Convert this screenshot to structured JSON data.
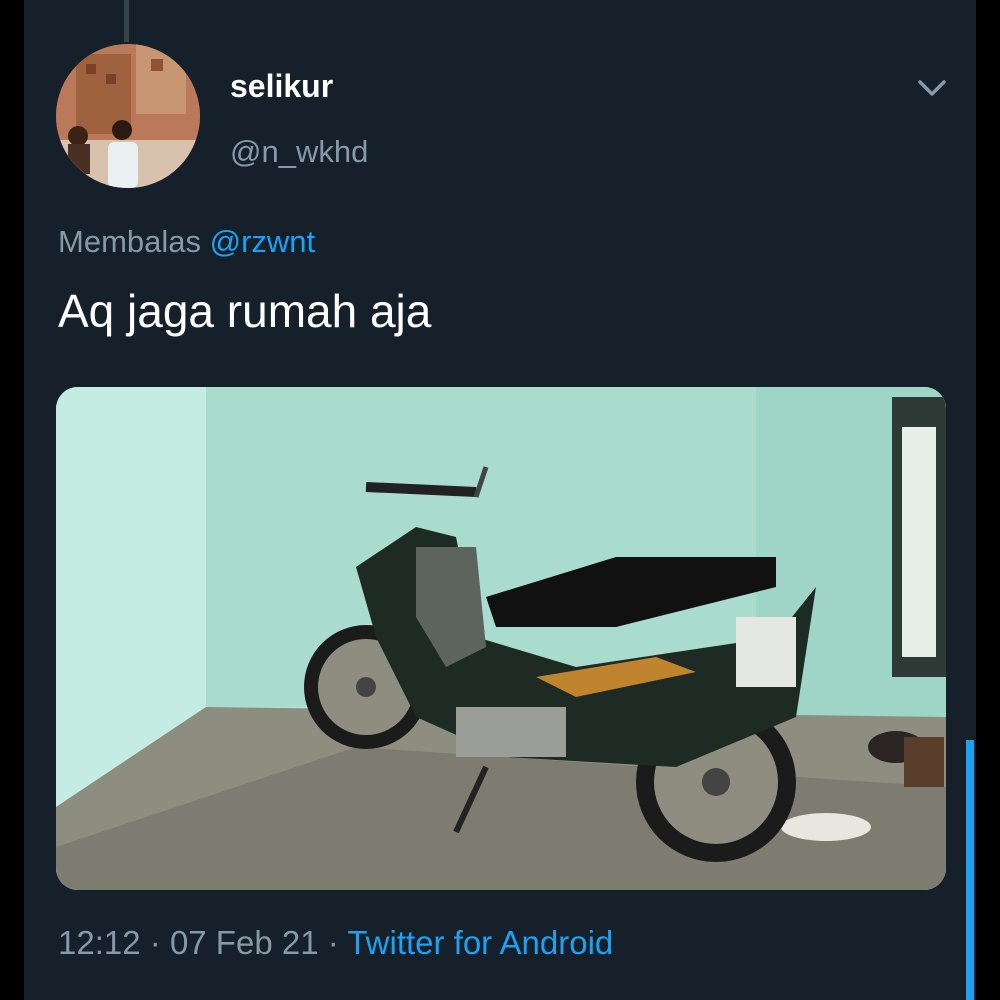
{
  "tweet": {
    "display_name": "selikur",
    "handle": "@n_wkhd",
    "reply_prefix": "Membalas",
    "reply_to": "@rzwnt",
    "text": "Aq jaga rumah aja",
    "time": "12:12",
    "separator": "·",
    "date": "07 Feb 21",
    "source": "Twitter for Android",
    "more_icon": "chevron-down-icon",
    "media_description_icon": "photo"
  },
  "colors": {
    "background": "#15202b",
    "accent": "#1da1f2",
    "secondary_text": "#8899a6",
    "primary_text": "#ffffff"
  }
}
